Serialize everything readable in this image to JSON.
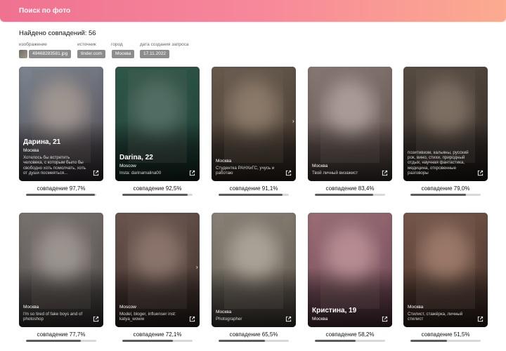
{
  "header": {
    "title": "Поиск по фото"
  },
  "summary": {
    "found_label": "Найдено совпадений: 56"
  },
  "query": {
    "labels": {
      "image": "изображение",
      "source": "источник",
      "city": "город",
      "date": "дата создания запроса"
    },
    "values": {
      "image": "49468283581.jpg",
      "source": "tinder.com",
      "city": "Москва",
      "date": "17.11.2022"
    }
  },
  "results": [
    {
      "name": "Дарина, 21",
      "city": "Москва",
      "desc": "Хотелось бы встретить человека, с которым было бы свободно хоть помолчать, хоть от души посмеяться...",
      "match": "совпадение 97,7%",
      "pct": 97.7,
      "colors": [
        "#7f8a96",
        "#4a3e44",
        "#a59c98"
      ]
    },
    {
      "name": "Darina, 22",
      "city": "Moscow",
      "desc": "Insta: darinamalina00",
      "match": "совпадение 92,5%",
      "pct": 92.5,
      "colors": [
        "#2f5a4a",
        "#1d3a33",
        "#4b6e63"
      ]
    },
    {
      "name": "",
      "city": "Москва",
      "desc": "Студентка РАНХиГС, учусь и работаю",
      "match": "совпадение 91,1%",
      "pct": 91.1,
      "colors": [
        "#6a5d4f",
        "#3d3128",
        "#8d7b69"
      ]
    },
    {
      "name": "",
      "city": "Москва",
      "desc": "Твой личный визажист",
      "match": "совпадение 83,4%",
      "pct": 83.4,
      "colors": [
        "#8b7b76",
        "#584844",
        "#b3a39f"
      ]
    },
    {
      "name": "",
      "city": "",
      "desc": "позитивизм, кальяны, русский рок, вино, стихи, природный отдых, научная фантастика, медицина, откровенные разговоры",
      "match": "совпадение 79,0%",
      "pct": 79.0,
      "colors": [
        "#5a4e44",
        "#2a2420",
        "#7e6f62"
      ]
    },
    {
      "name": "",
      "city": "Москва",
      "desc": "I'm so tired of fake boys and of photoshop",
      "match": "совпадение 77,7%",
      "pct": 77.7,
      "colors": [
        "#7b7572",
        "#4b4644",
        "#a09a96"
      ]
    },
    {
      "name": "",
      "city": "Moscow",
      "desc": "Model, bloger, influenser inst: katya_woww",
      "match": "совпадение 72,1%",
      "pct": 72.1,
      "colors": [
        "#6e5750",
        "#3a2c28",
        "#8d756c"
      ]
    },
    {
      "name": "",
      "city": "Москва",
      "desc": "Photographer",
      "match": "совпадение 65,5%",
      "pct": 65.5,
      "colors": [
        "#8a857a",
        "#5b5248",
        "#b2ab9e"
      ]
    },
    {
      "name": "Кристина, 19",
      "city": "Москва",
      "desc": "",
      "match": "совпадение 58,2%",
      "pct": 58.2,
      "colors": [
        "#9e6f78",
        "#6b4452",
        "#c2919a"
      ]
    },
    {
      "name": "",
      "city": "Москва",
      "desc": "Стилист, стажёрка, личный стилист",
      "match": "совпадение 51,5%",
      "pct": 51.5,
      "colors": [
        "#7a5a4c",
        "#3e2a22",
        "#a07a68"
      ]
    }
  ]
}
